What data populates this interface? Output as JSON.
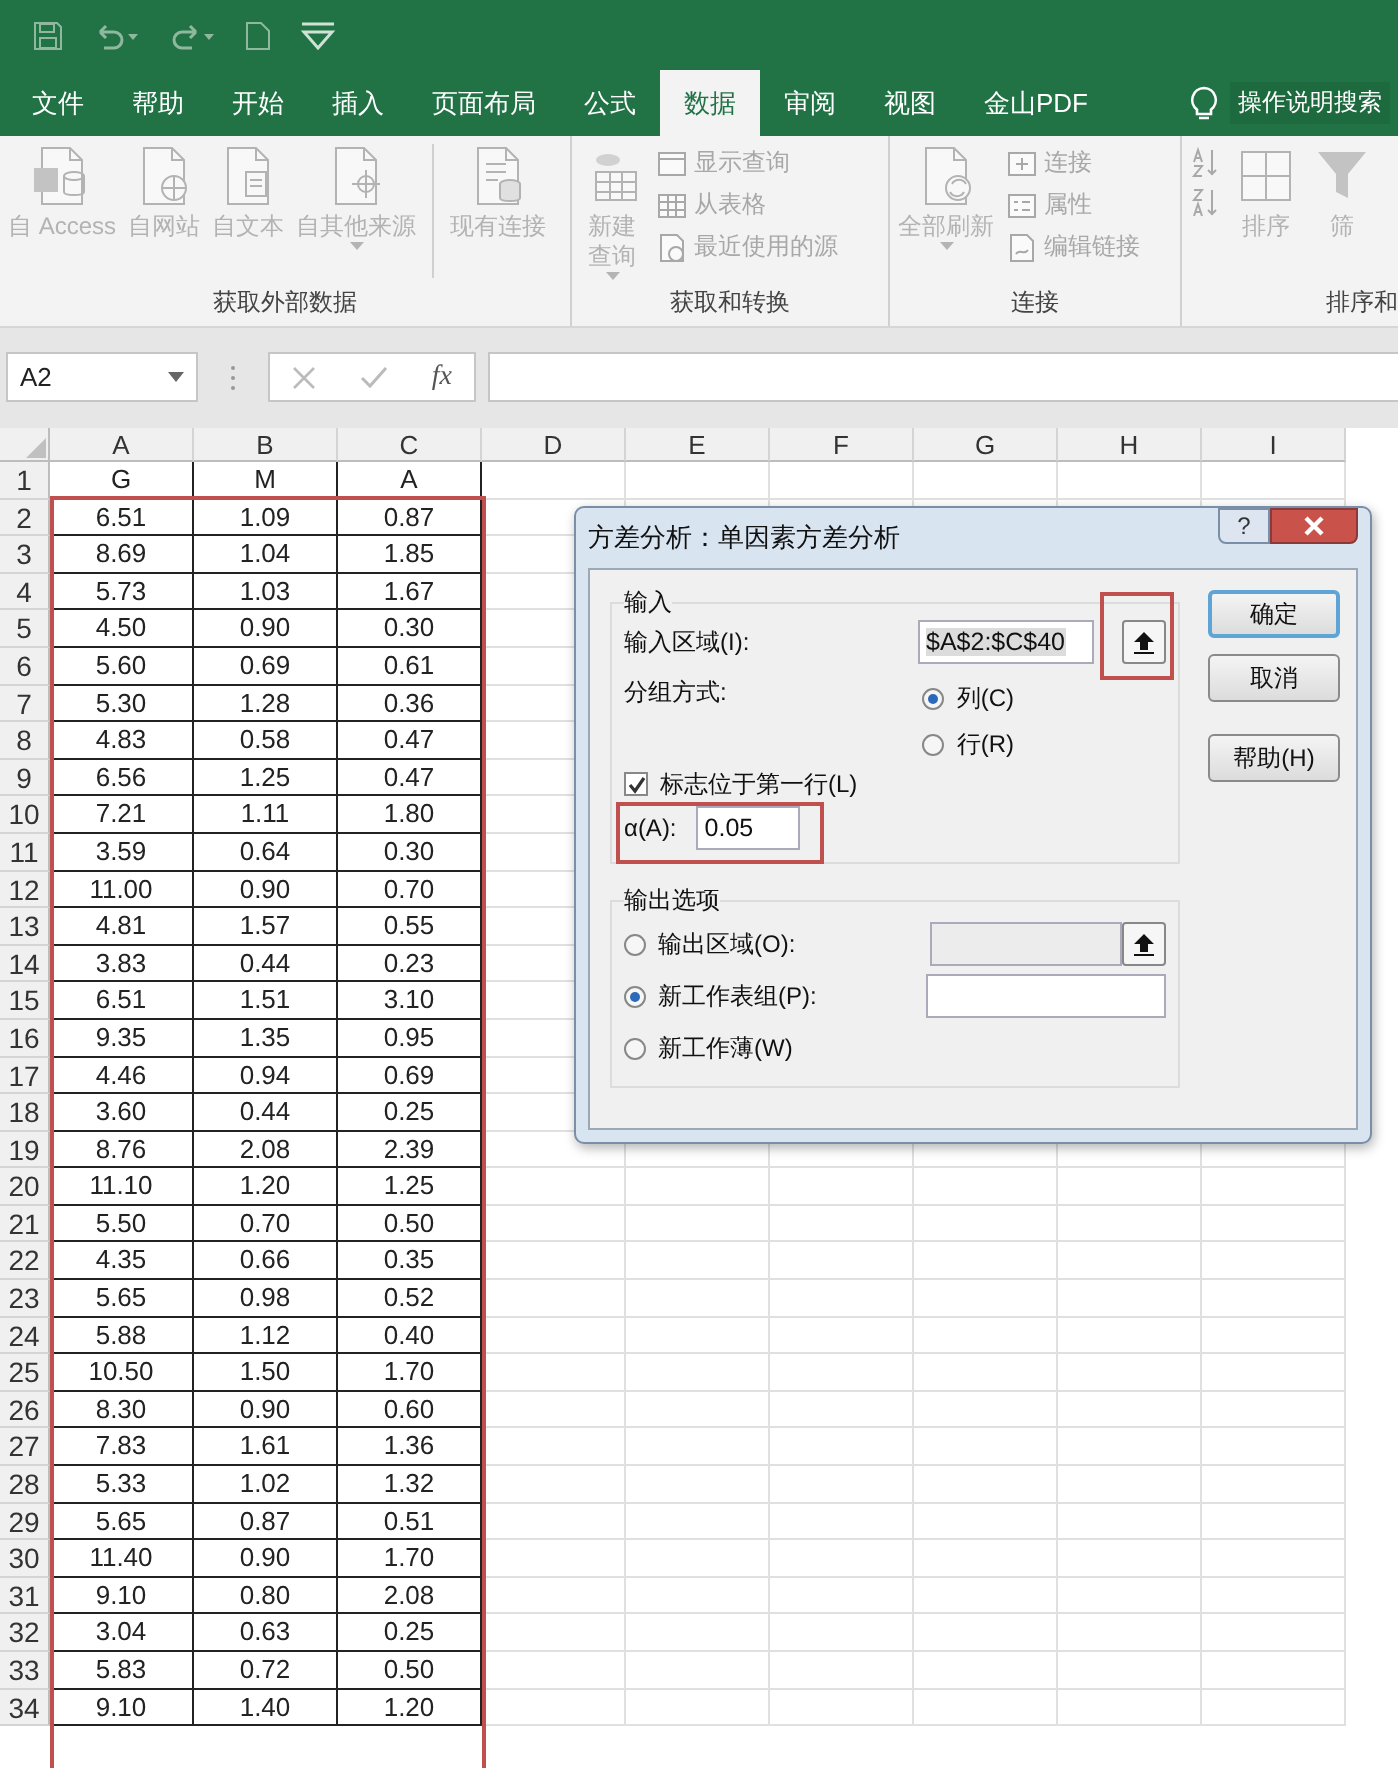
{
  "tabs": [
    {
      "label": "文件",
      "selected": false
    },
    {
      "label": "帮助",
      "selected": false
    },
    {
      "label": "开始",
      "selected": false
    },
    {
      "label": "插入",
      "selected": false
    },
    {
      "label": "页面布局",
      "selected": false
    },
    {
      "label": "公式",
      "selected": false
    },
    {
      "label": "数据",
      "selected": true
    },
    {
      "label": "审阅",
      "selected": false
    },
    {
      "label": "视图",
      "selected": false
    },
    {
      "label": "金山PDF",
      "selected": false
    }
  ],
  "tell_me": "操作说明搜索",
  "ribbon_groups": [
    {
      "label": "获取外部数据",
      "buttons": [
        {
          "kind": "large",
          "label": "自 Access",
          "disabled": true,
          "dropdown": false
        },
        {
          "kind": "large",
          "label": "自网站",
          "disabled": true,
          "dropdown": false
        },
        {
          "kind": "large",
          "label": "自文本",
          "disabled": true,
          "dropdown": false
        },
        {
          "kind": "large",
          "label": "自其他来源",
          "disabled": true,
          "dropdown": true
        },
        {
          "kind": "large",
          "label": "现有连接",
          "disabled": true,
          "dropdown": false
        }
      ]
    },
    {
      "label": "获取和转换",
      "buttons": [
        {
          "kind": "large",
          "label": "新建查询",
          "disabled": true,
          "dropdown": true
        },
        {
          "kind": "small",
          "label": "显示查询",
          "disabled": true,
          "dropdown": false
        },
        {
          "kind": "small",
          "label": "从表格",
          "disabled": true,
          "dropdown": false
        },
        {
          "kind": "small",
          "label": "最近使用的源",
          "disabled": true,
          "dropdown": false
        }
      ]
    },
    {
      "label": "连接",
      "buttons": [
        {
          "kind": "large",
          "label": "全部刷新",
          "disabled": true,
          "dropdown": true
        },
        {
          "kind": "small",
          "label": "连接",
          "disabled": true,
          "dropdown": false
        },
        {
          "kind": "small",
          "label": "属性",
          "disabled": true,
          "dropdown": false
        },
        {
          "kind": "small",
          "label": "编辑链接",
          "disabled": true,
          "dropdown": false
        }
      ]
    },
    {
      "label": "排序和",
      "buttons": [
        {
          "kind": "small",
          "disabled": true,
          "dropdown": false
        },
        {
          "kind": "small",
          "disabled": true,
          "dropdown": false
        },
        {
          "kind": "large",
          "label": "排序",
          "disabled": true,
          "dropdown": false
        },
        {
          "kind": "large",
          "label": "筛",
          "disabled": true,
          "dropdown": false
        }
      ]
    }
  ],
  "name_box": "A2",
  "function_label": "fx",
  "columns": [
    "A",
    "B",
    "C",
    "D",
    "E",
    "F",
    "G",
    "H",
    "I"
  ],
  "rows": [
    {
      "number": "1",
      "cells": [
        "G",
        "M",
        "A"
      ]
    },
    {
      "number": "2",
      "cells": [
        "6.51",
        "1.09",
        "0.87"
      ]
    },
    {
      "number": "3",
      "cells": [
        "8.69",
        "1.04",
        "1.85"
      ]
    },
    {
      "number": "4",
      "cells": [
        "5.73",
        "1.03",
        "1.67"
      ]
    },
    {
      "number": "5",
      "cells": [
        "4.50",
        "0.90",
        "0.30"
      ]
    },
    {
      "number": "6",
      "cells": [
        "5.60",
        "0.69",
        "0.61"
      ]
    },
    {
      "number": "7",
      "cells": [
        "5.30",
        "1.28",
        "0.36"
      ]
    },
    {
      "number": "8",
      "cells": [
        "4.83",
        "0.58",
        "0.47"
      ]
    },
    {
      "number": "9",
      "cells": [
        "6.56",
        "1.25",
        "0.47"
      ]
    },
    {
      "number": "10",
      "cells": [
        "7.21",
        "1.11",
        "1.80"
      ]
    },
    {
      "number": "11",
      "cells": [
        "3.59",
        "0.64",
        "0.30"
      ]
    },
    {
      "number": "12",
      "cells": [
        "11.00",
        "0.90",
        "0.70"
      ]
    },
    {
      "number": "13",
      "cells": [
        "4.81",
        "1.57",
        "0.55"
      ]
    },
    {
      "number": "14",
      "cells": [
        "3.83",
        "0.44",
        "0.23"
      ]
    },
    {
      "number": "15",
      "cells": [
        "6.51",
        "1.51",
        "3.10"
      ]
    },
    {
      "number": "16",
      "cells": [
        "9.35",
        "1.35",
        "0.95"
      ]
    },
    {
      "number": "17",
      "cells": [
        "4.46",
        "0.94",
        "0.69"
      ]
    },
    {
      "number": "18",
      "cells": [
        "3.60",
        "0.44",
        "0.25"
      ]
    },
    {
      "number": "19",
      "cells": [
        "8.76",
        "2.08",
        "2.39"
      ]
    },
    {
      "number": "20",
      "cells": [
        "11.10",
        "1.20",
        "1.25"
      ]
    },
    {
      "number": "21",
      "cells": [
        "5.50",
        "0.70",
        "0.50"
      ]
    },
    {
      "number": "22",
      "cells": [
        "4.35",
        "0.66",
        "0.35"
      ]
    },
    {
      "number": "23",
      "cells": [
        "5.65",
        "0.98",
        "0.52"
      ]
    },
    {
      "number": "24",
      "cells": [
        "5.88",
        "1.12",
        "0.40"
      ]
    },
    {
      "number": "25",
      "cells": [
        "10.50",
        "1.50",
        "1.70"
      ]
    },
    {
      "number": "26",
      "cells": [
        "8.30",
        "0.90",
        "0.60"
      ]
    },
    {
      "number": "27",
      "cells": [
        "7.83",
        "1.61",
        "1.36"
      ]
    },
    {
      "number": "28",
      "cells": [
        "5.33",
        "1.02",
        "1.32"
      ]
    },
    {
      "number": "29",
      "cells": [
        "5.65",
        "0.87",
        "0.51"
      ]
    },
    {
      "number": "30",
      "cells": [
        "11.40",
        "0.90",
        "1.70"
      ]
    },
    {
      "number": "31",
      "cells": [
        "9.10",
        "0.80",
        "2.08"
      ]
    },
    {
      "number": "32",
      "cells": [
        "3.04",
        "0.63",
        "0.25"
      ]
    },
    {
      "number": "33",
      "cells": [
        "5.83",
        "0.72",
        "0.50"
      ]
    },
    {
      "number": "34",
      "cells": [
        "9.10",
        "1.40",
        "1.20"
      ]
    }
  ],
  "dialog": {
    "title": "方差分析：单因素方差分析",
    "help_button": "?",
    "input_group": {
      "label": "输入",
      "range_label": "输入区域(I):",
      "range_value": "$A$2:$C$40",
      "grouping_label": "分组方式:",
      "grouping": [
        {
          "label": "列(C)",
          "selected": true
        },
        {
          "label": "行(R)",
          "selected": false
        }
      ],
      "first_row": {
        "label": "标志位于第一行(L)",
        "checked": true
      },
      "alpha_label": "α(A):",
      "alpha_value": "0.05"
    },
    "output_group": {
      "label": "输出选项",
      "options": [
        {
          "kind": "range",
          "label": "输出区域(O):",
          "selected": false
        },
        {
          "kind": "sheet",
          "label": "新工作表组(P):",
          "selected": true
        },
        {
          "kind": "workbook",
          "label": "新工作薄(W)",
          "selected": false
        }
      ]
    },
    "buttons": [
      {
        "label": "确定",
        "default": true
      },
      {
        "label": "取消",
        "default": false
      },
      {
        "label": "帮助(H)",
        "default": false
      }
    ]
  }
}
